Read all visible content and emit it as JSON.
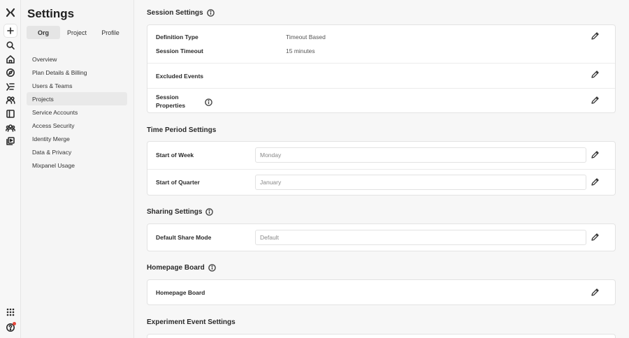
{
  "rail": {
    "icons": [
      "logo-icon",
      "plus-icon",
      "search-icon",
      "home-icon",
      "compass-icon",
      "lab-icon",
      "users-icon",
      "boards-icon",
      "teams-icon",
      "library-icon",
      "apps-grid-icon",
      "help-icon"
    ]
  },
  "nav": {
    "title": "Settings",
    "tabs": [
      {
        "label": "Org"
      },
      {
        "label": "Project"
      },
      {
        "label": "Profile"
      }
    ],
    "items": [
      {
        "label": "Overview"
      },
      {
        "label": "Plan Details & Billing"
      },
      {
        "label": "Users & Teams"
      },
      {
        "label": "Projects"
      },
      {
        "label": "Service Accounts"
      },
      {
        "label": "Access Security"
      },
      {
        "label": "Identity Merge"
      },
      {
        "label": "Data & Privacy"
      },
      {
        "label": "Mixpanel Usage"
      }
    ]
  },
  "main": {
    "session": {
      "title": "Session Settings",
      "definition_label": "Definition Type",
      "definition_value": "Timeout Based",
      "timeout_label": "Session Timeout",
      "timeout_value": "15 minutes",
      "excluded_label": "Excluded Events",
      "properties_label_1": "Session",
      "properties_label_2": "Properties"
    },
    "time_period": {
      "title": "Time Period Settings",
      "week_label": "Start of Week",
      "week_value": "Monday",
      "quarter_label": "Start of Quarter",
      "quarter_value": "January"
    },
    "sharing": {
      "title": "Sharing Settings",
      "mode_label": "Default Share Mode",
      "mode_value": "Default"
    },
    "homepage": {
      "title": "Homepage Board",
      "row_label": "Homepage Board"
    },
    "experiment": {
      "title": "Experiment Event Settings"
    }
  },
  "colors": {
    "background": "#f7f7f7",
    "card": "#ffffff",
    "notification_dot": "#e4473b"
  }
}
